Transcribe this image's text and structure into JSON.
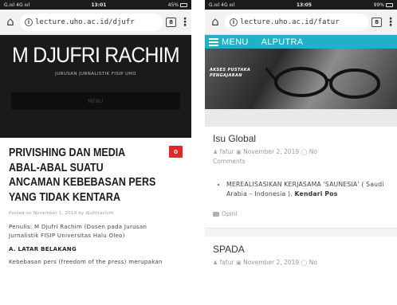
{
  "left": {
    "status": {
      "carrier": "G.ıııl 4G ıııl",
      "time": "13:01",
      "battery": "45%"
    },
    "browser": {
      "url": "lecture.uho.ac.id/djufr",
      "tabs_count": "8"
    },
    "site": {
      "title": "M DJUFRI RACHIM",
      "subtitle": "JURUSAN JURNALISTIK FISIP UHO",
      "menu_label": "MENU"
    },
    "article": {
      "title_lines": [
        "PRIVISHING DAN MEDIA",
        "ABAL-ABAL SUATU",
        "ANCAMAN KEBEBASAN PERS",
        "YANG TIDAK KENTARA"
      ],
      "comment_count": "0",
      "posted": "Posted on November 1, 2019 by djufrirachim",
      "author_lines": [
        "Penulis: M Djufri Rachim (Dosen pada Jurusan",
        "Jurnalistik FISIP Universitas Halu Oleo)"
      ],
      "section_heading": "A. LATAR BELAKANG",
      "body_start": "Kebebasan pers (freedom of the press) merupakan"
    }
  },
  "right": {
    "status": {
      "carrier": "G.ıııl 4G ıııl",
      "time": "13:05",
      "battery": "99%"
    },
    "browser": {
      "url": "lecture.uho.ac.id/fatur",
      "tabs_count": "8"
    },
    "menu": {
      "label": "MENU",
      "brand": "ALPUTRA"
    },
    "hero": {
      "caption_lines": [
        "AKSES PUSTAKA",
        "PENGAJARAN"
      ]
    },
    "posts": [
      {
        "title": "Isu Global",
        "author": "fatur",
        "date": "November 2, 2019",
        "comments_line1": "No",
        "comments_line2": "Comments",
        "list_item": "MEREALISASIKAN KERJASAMA 'SAUNESIA' ( Saudi Arabia – Indonesia ).",
        "list_item_bold": "Kendari Pos",
        "category": "Opini"
      },
      {
        "title": "SPADA",
        "author": "fatur",
        "date": "November 2, 2019",
        "comments_line1": "No"
      }
    ]
  },
  "colors": {
    "accent_teal": "#1fb2c7",
    "badge_red": "#e3262a",
    "header_dark": "#1a1a1a"
  },
  "icons": [
    "home-icon",
    "info-icon",
    "tabs-icon",
    "kebab-menu-icon",
    "hamburger-icon",
    "user-icon",
    "calendar-icon",
    "comment-icon",
    "folder-icon"
  ]
}
